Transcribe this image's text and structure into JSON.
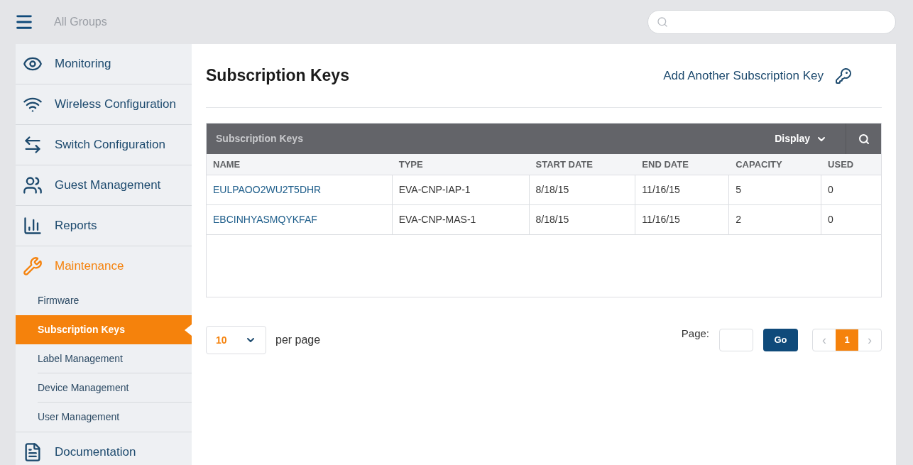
{
  "header": {
    "group": "All Groups"
  },
  "sidebar": {
    "items": [
      {
        "label": "Monitoring",
        "selected": false
      },
      {
        "label": "Wireless Configuration",
        "selected": false
      },
      {
        "label": "Switch Configuration",
        "selected": false
      },
      {
        "label": "Guest Management",
        "selected": false
      },
      {
        "label": "Reports",
        "selected": false
      },
      {
        "label": "Maintenance",
        "selected": true,
        "expanded": true,
        "children": [
          {
            "label": "Firmware",
            "selected": false
          },
          {
            "label": "Subscription Keys",
            "selected": true
          },
          {
            "label": "Label Management",
            "selected": false
          },
          {
            "label": "Device Management",
            "selected": false
          },
          {
            "label": "User Management",
            "selected": false
          }
        ]
      },
      {
        "label": "Documentation",
        "selected": false
      }
    ]
  },
  "page": {
    "title": "Subscription Keys",
    "add_link": "Add Another Subscription Key"
  },
  "table": {
    "title": "Subscription Keys",
    "display": "Display",
    "columns": [
      "NAME",
      "TYPE",
      "START DATE",
      "END DATE",
      "CAPACITY",
      "USED"
    ],
    "rows": [
      [
        "EULPAOO2WU2T5DHR",
        "EVA-CNP-IAP-1",
        "8/18/15",
        "11/16/15",
        "5",
        "0"
      ],
      [
        "EBCINHYASMQYKFAF",
        "EVA-CNP-MAS-1",
        "8/18/15",
        "11/16/15",
        "2",
        "0"
      ]
    ]
  },
  "pagination": {
    "per_page_value": "10",
    "per_page_label": "per page",
    "page_label": "Page:",
    "go": "Go",
    "prev": "‹",
    "next": "›",
    "pages": [
      {
        "label": "1",
        "selected": true
      }
    ]
  }
}
